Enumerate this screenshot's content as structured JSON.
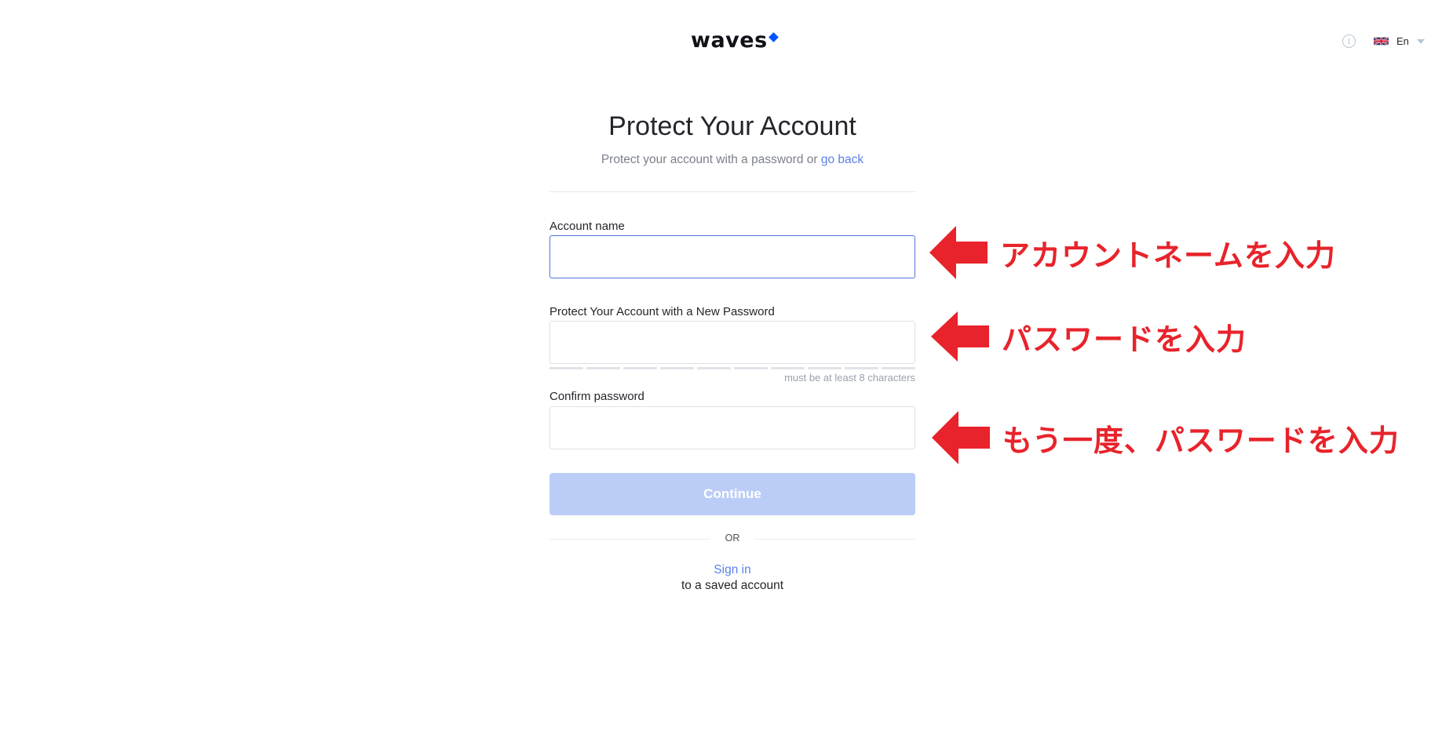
{
  "header": {
    "logo_text": "waves",
    "info_icon": "info-icon",
    "language": "En"
  },
  "form": {
    "title": "Protect Your Account",
    "subtitle_prefix": "Protect your account with a password or ",
    "subtitle_link": "go back",
    "account_name_label": "Account name",
    "account_name_value": "",
    "password_label": "Protect Your Account with a New Password",
    "password_value": "",
    "password_hint": "must be at least 8 characters",
    "confirm_label": "Confirm password",
    "confirm_value": "",
    "continue_label": "Continue",
    "or_label": "OR",
    "signin_label": "Sign in",
    "saved_account_label": "to a saved account"
  },
  "annotations": {
    "account_name_note": "アカウントネームを入力",
    "password_note": "パスワードを入力",
    "confirm_note": "もう一度、パスワードを入力",
    "color": "#e8232b"
  },
  "colors": {
    "accent": "#5a81ea",
    "button_disabled": "#bbcdf7",
    "logo_mark": "#0055ff"
  }
}
